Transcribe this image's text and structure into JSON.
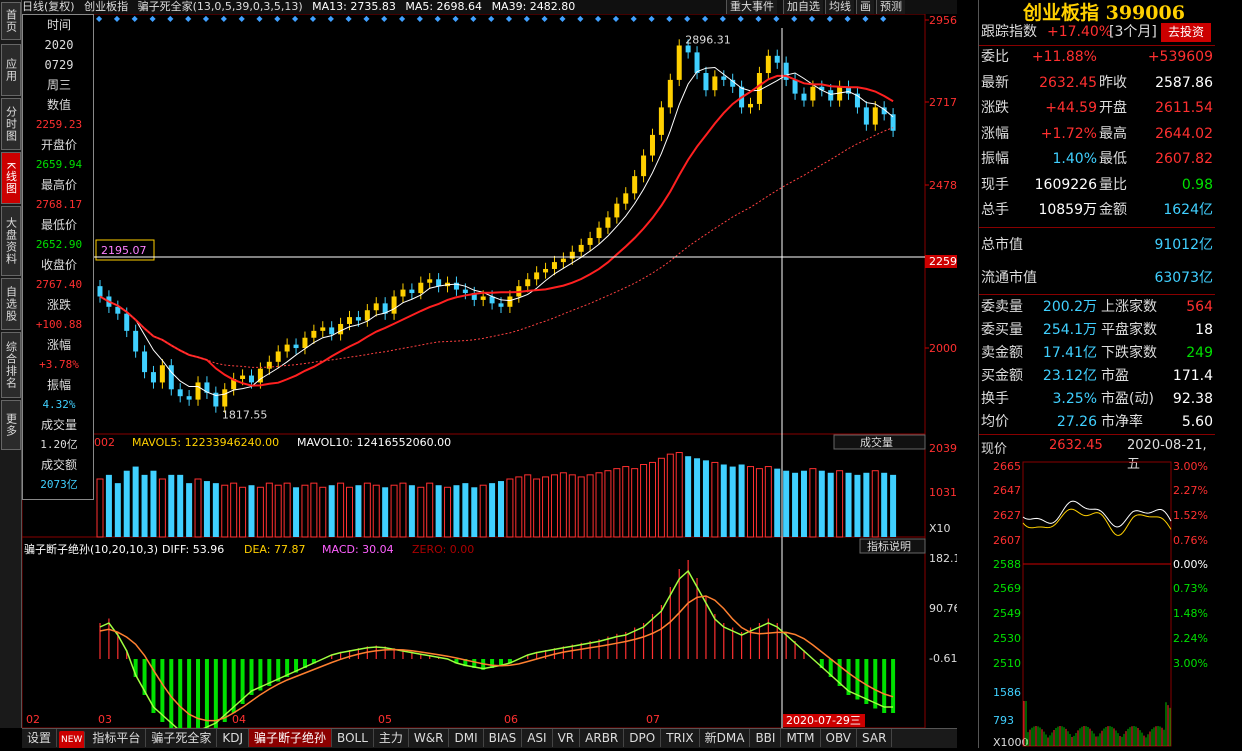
{
  "left_tabs": [
    "首页",
    "应用",
    "分时图",
    "K线图",
    "大盘资料",
    "自选股",
    "综合排名",
    "更多"
  ],
  "top": {
    "period": "日线(复权)",
    "name": "创业板指",
    "indicator": "骗子死全家(13,0,5,39,0,3,5,13)",
    "ma13": "MA13: 2735.83",
    "ma5": "MA5: 2698.64",
    "ma39": "MA39: 2482.80"
  },
  "top_buttons": [
    "重大事件",
    "加自选",
    "均线",
    "画",
    "预测"
  ],
  "price_axis": [
    "2956",
    "2717",
    "2478",
    "2259",
    "2000"
  ],
  "price_labels": {
    "high": "2896.31",
    "low": "1817.55",
    "cursor": "2195.07"
  },
  "vol_panel": {
    "title": "002",
    "mavol5": "MAVOL5: 12233946240.00",
    "mavol10": "MAVOL10: 12416552060.00",
    "selector": "成交量",
    "axis": [
      "2039",
      "1031",
      "X10"
    ]
  },
  "macd_panel": {
    "title": "骗子断子绝孙(10,20,10,3)",
    "diff": "DIFF: 53.96",
    "dea": "DEA: 77.87",
    "macd": "MACD: 30.04",
    "zero": "ZERO: 0.00",
    "help": "指标说明",
    "axis": [
      "182.14",
      "90.76",
      "-0.61"
    ]
  },
  "date_axis": [
    "02",
    "03",
    "04",
    "05",
    "06",
    "07"
  ],
  "cursor_date": "2020-07-29三",
  "info": {
    "time_label": "时间",
    "year": "2020",
    "date": "0729",
    "weekday": "周三",
    "value_label": "数值",
    "value": "2259.23",
    "open_label": "开盘价",
    "open": "2659.94",
    "high_label": "最高价",
    "high": "2768.17",
    "low_label": "最低价",
    "low": "2652.90",
    "close_label": "收盘价",
    "close": "2767.40",
    "chg_label": "涨跌",
    "chg": "+100.88",
    "pct_label": "涨幅",
    "pct": "+3.78%",
    "amp_label": "振幅",
    "amp": "4.32%",
    "vol_label": "成交量",
    "vol": "1.20亿",
    "amt_label": "成交额",
    "amt": "2073亿"
  },
  "right": {
    "title": "创业板指 399006",
    "track": "跟踪指数",
    "track_val": "+17.40%",
    "track_period": "[3个月]",
    "invest": "去投资",
    "rows": [
      [
        "委比",
        "+11.88%",
        "",
        "+539609"
      ],
      [
        "最新",
        "2632.45",
        "昨收",
        "2587.86"
      ],
      [
        "涨跌",
        "+44.59",
        "开盘",
        "2611.54"
      ],
      [
        "涨幅",
        "+1.72%",
        "最高",
        "2644.02"
      ],
      [
        "振幅",
        "1.40%",
        "最低",
        "2607.82"
      ],
      [
        "现手",
        "1609226",
        "量比",
        "0.98"
      ],
      [
        "总手",
        "10859万",
        "金额",
        "1624亿"
      ]
    ],
    "mcap_label": "总市值",
    "mcap": "91012亿",
    "float_label": "流通市值",
    "float": "63073亿",
    "rows2": [
      [
        "委卖量",
        "200.2万",
        "上涨家数",
        "564"
      ],
      [
        "委买量",
        "254.1万",
        "平盘家数",
        "18"
      ],
      [
        "卖金额",
        "17.41亿",
        "下跌家数",
        "249"
      ],
      [
        "买金额",
        "23.12亿",
        "市盈",
        "171.4"
      ],
      [
        "换手",
        "3.25%",
        "市盈(动)",
        "92.38"
      ],
      [
        "均价",
        "27.26",
        "市净率",
        "5.60"
      ]
    ],
    "now_label": "现价",
    "now": "2632.45",
    "now_date": "2020-08-21,五",
    "mini_left": [
      "2665",
      "2647",
      "2627",
      "2607",
      "2588",
      "2569",
      "2549",
      "2530",
      "2510",
      "1586",
      "793",
      "X1000"
    ],
    "mini_right": [
      "3.00%",
      "2.27%",
      "1.52%",
      "0.76%",
      "0.00%",
      "0.73%",
      "1.48%",
      "2.24%",
      "3.00%"
    ]
  },
  "bottom_tabs": [
    "设置",
    "NEW",
    "指标平台",
    "骗子死全家",
    "KDJ",
    "骗子断子绝孙",
    "BOLL",
    "主力",
    "W&R",
    "DMI",
    "BIAS",
    "ASI",
    "VR",
    "ARBR",
    "DPO",
    "TRIX",
    "新DMA",
    "BBI",
    "MTM",
    "OBV",
    "SAR"
  ],
  "chart_data": {
    "type": "candlestick",
    "ylim": [
      1750,
      2960
    ],
    "x_months": [
      "02",
      "03",
      "04",
      "05",
      "06",
      "07"
    ],
    "close": [
      2150,
      2120,
      2100,
      2050,
      1990,
      1930,
      1900,
      1950,
      1880,
      1860,
      1850,
      1900,
      1870,
      1830,
      1880,
      1910,
      1920,
      1900,
      1940,
      1960,
      1990,
      2010,
      2000,
      2030,
      2050,
      2060,
      2040,
      2070,
      2090,
      2080,
      2110,
      2130,
      2100,
      2150,
      2170,
      2160,
      2190,
      2200,
      2180,
      2190,
      2170,
      2160,
      2140,
      2150,
      2130,
      2120,
      2150,
      2180,
      2200,
      2220,
      2230,
      2250,
      2260,
      2280,
      2300,
      2320,
      2350,
      2380,
      2420,
      2450,
      2500,
      2560,
      2620,
      2700,
      2780,
      2880,
      2860,
      2800,
      2750,
      2790,
      2780,
      2760,
      2700,
      2710,
      2800,
      2850,
      2830,
      2780,
      2740,
      2720,
      2760,
      2750,
      2720,
      2760,
      2740,
      2700,
      2650,
      2700,
      2680,
      2632
    ],
    "vol": [
      1400,
      1500,
      1300,
      1600,
      1700,
      1500,
      1600,
      1400,
      1500,
      1500,
      1300,
      1400,
      1350,
      1300,
      1250,
      1300,
      1200,
      1250,
      1200,
      1300,
      1250,
      1300,
      1200,
      1250,
      1300,
      1200,
      1250,
      1300,
      1200,
      1250,
      1300,
      1250,
      1200,
      1250,
      1300,
      1250,
      1200,
      1300,
      1250,
      1200,
      1250,
      1300,
      1200,
      1250,
      1300,
      1350,
      1400,
      1450,
      1500,
      1400,
      1450,
      1500,
      1550,
      1500,
      1450,
      1500,
      1550,
      1600,
      1650,
      1700,
      1650,
      1750,
      1800,
      1900,
      2000,
      2039,
      1950,
      1900,
      1850,
      1800,
      1750,
      1700,
      1750,
      1700,
      1650,
      1700,
      1650,
      1600,
      1550,
      1600,
      1650,
      1600,
      1550,
      1600,
      1550,
      1500,
      1550,
      1600,
      1550,
      1500
    ],
    "macd": [
      40,
      45,
      30,
      10,
      -20,
      -40,
      -60,
      -70,
      -80,
      -90,
      -95,
      -90,
      -85,
      -80,
      -70,
      -60,
      -50,
      -40,
      -35,
      -30,
      -25,
      -20,
      -15,
      -10,
      -5,
      0,
      5,
      8,
      10,
      12,
      14,
      15,
      14,
      12,
      10,
      8,
      6,
      4,
      2,
      0,
      -5,
      -8,
      -10,
      -12,
      -10,
      -8,
      -5,
      0,
      5,
      8,
      10,
      12,
      14,
      16,
      18,
      20,
      22,
      25,
      28,
      30,
      35,
      40,
      50,
      60,
      80,
      100,
      110,
      90,
      70,
      50,
      40,
      35,
      30,
      35,
      40,
      45,
      40,
      30,
      20,
      10,
      0,
      -10,
      -20,
      -30,
      -40,
      -45,
      -50,
      -55,
      -60,
      -60
    ]
  }
}
